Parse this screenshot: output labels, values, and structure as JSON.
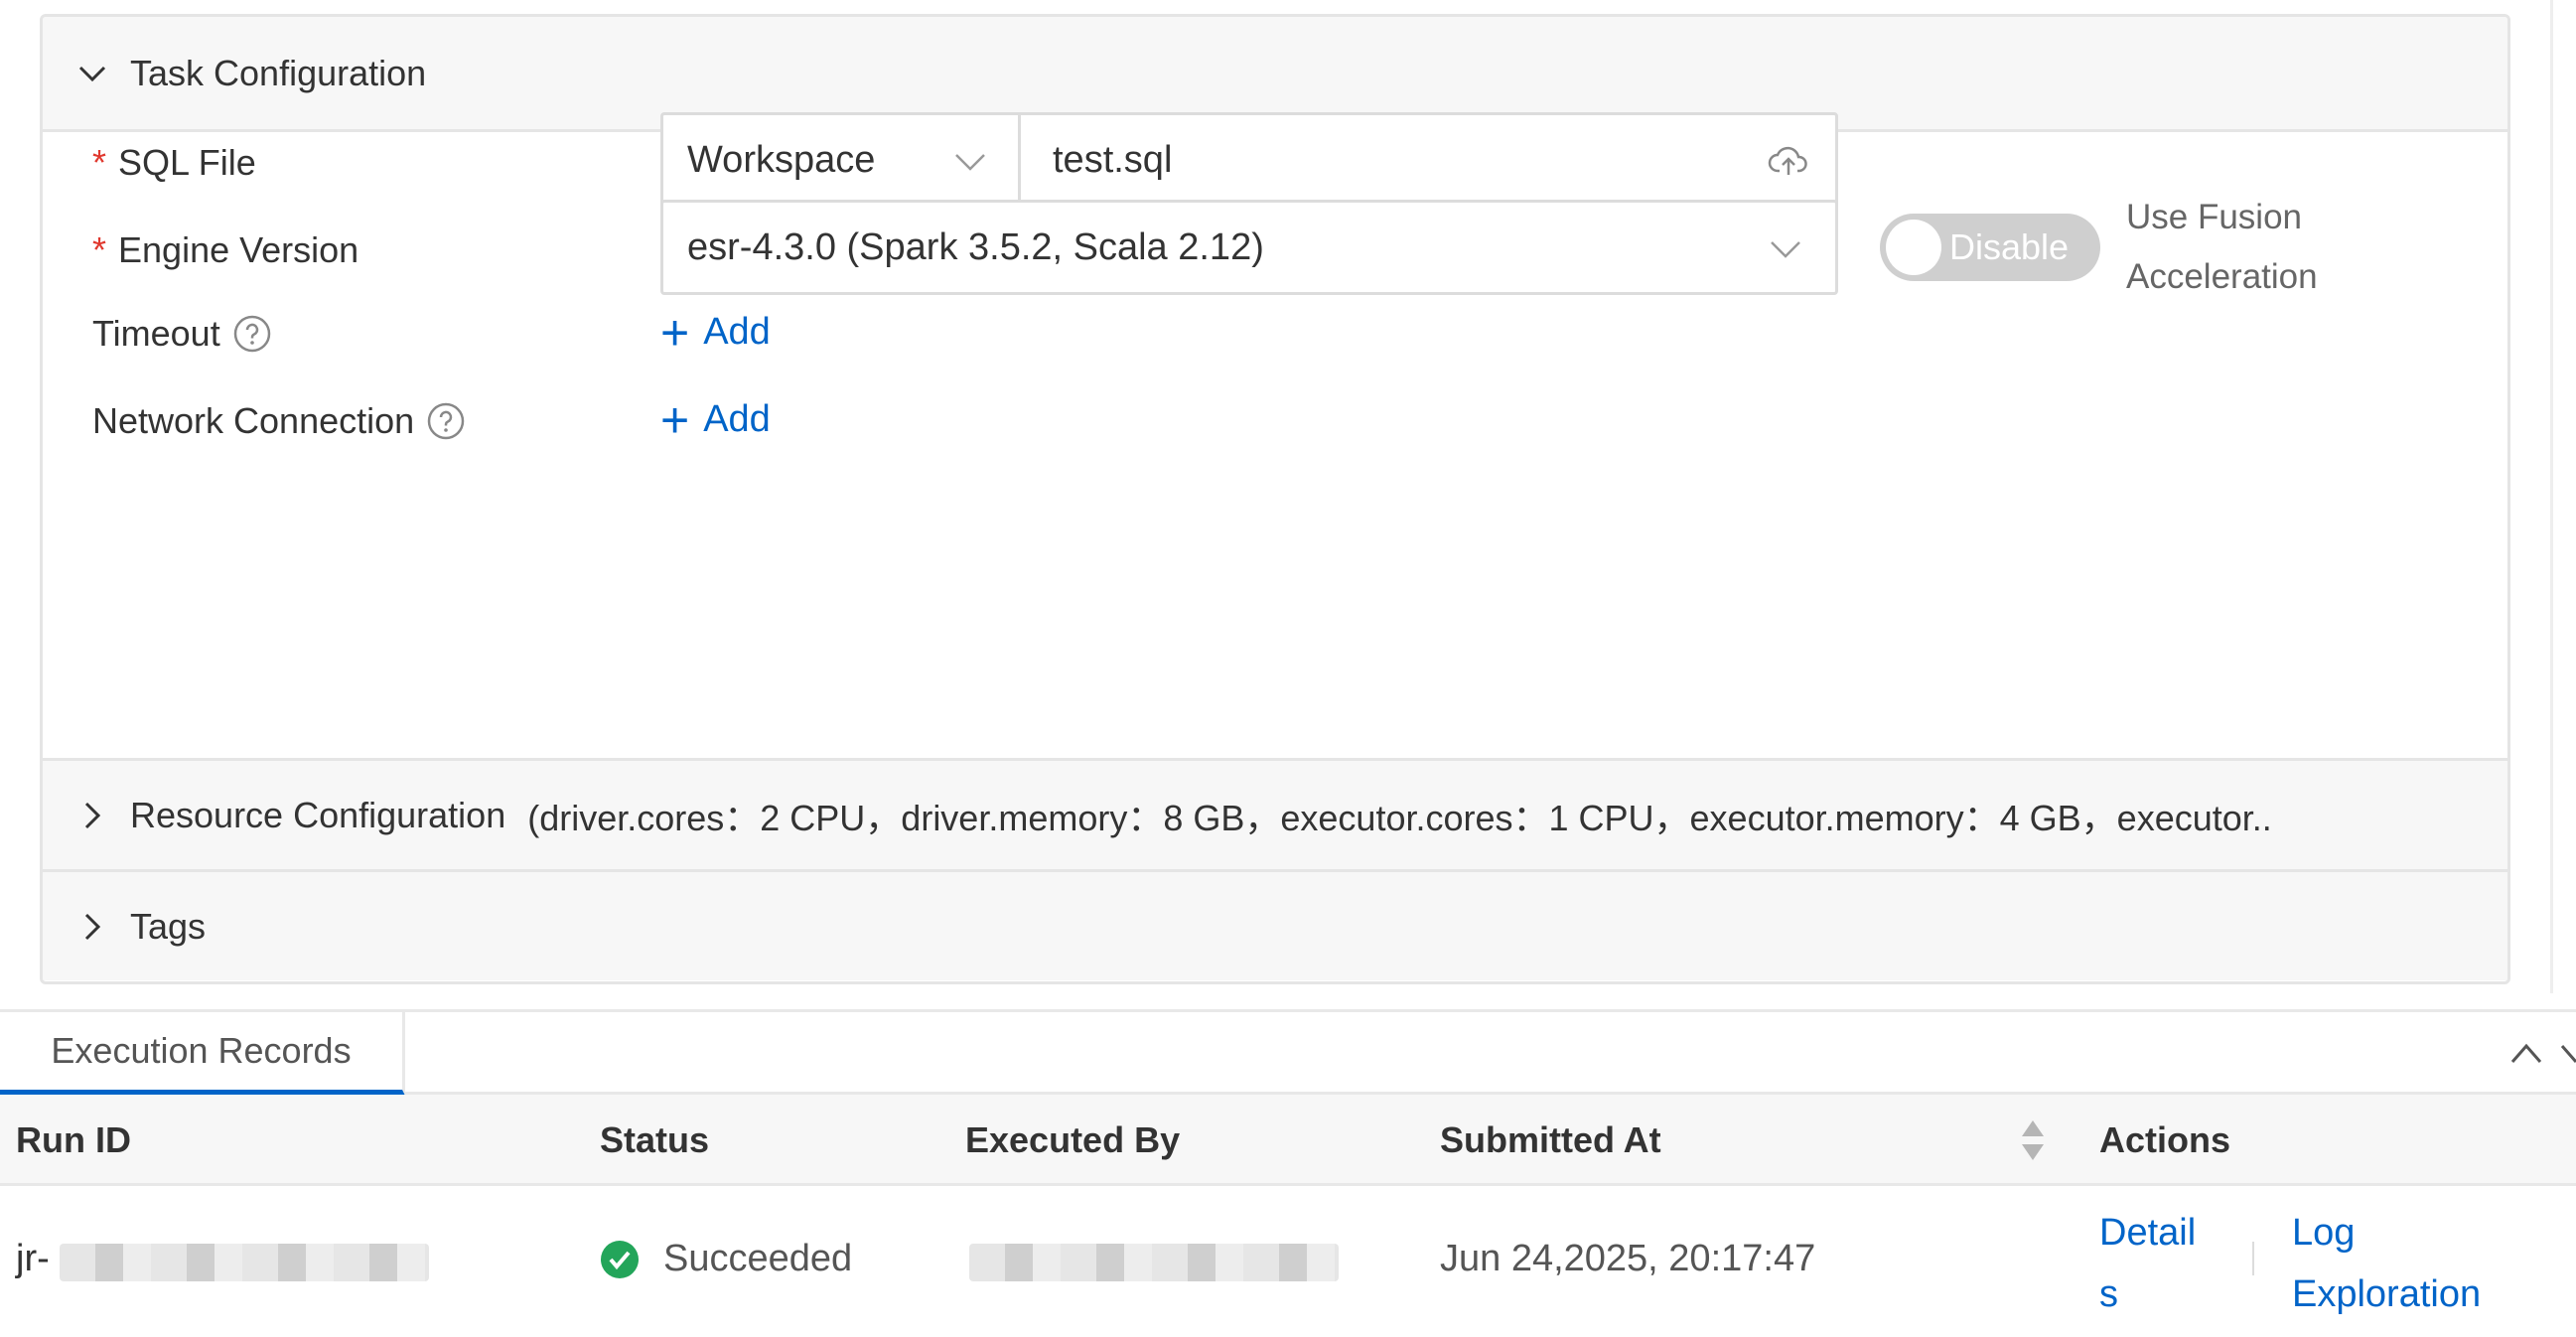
{
  "task_config": {
    "section_title": "Task Configuration",
    "sql_file": {
      "label": "SQL File",
      "required_mark": "*",
      "source_value": "Workspace",
      "file_value": "test.sql"
    },
    "engine_version": {
      "label": "Engine Version",
      "required_mark": "*",
      "value": "esr-4.3.0 (Spark 3.5.2, Scala 2.12)",
      "fusion_toggle_label": "Disable",
      "fusion_toggle_on": false,
      "fusion_label_line1": "Use Fusion",
      "fusion_label_line2": "Acceleration"
    },
    "timeout": {
      "label": "Timeout",
      "add_label": "Add"
    },
    "network_connection": {
      "label": "Network Connection",
      "add_label": "Add"
    },
    "resource_configuration": {
      "label": "Resource Configuration",
      "summary": "(driver.cores：2 CPU，driver.memory：8 GB，executor.cores：1 CPU，executor.memory：4 GB，executor.."
    },
    "tags": {
      "label": "Tags"
    }
  },
  "execution_records": {
    "tab_label": "Execution Records",
    "columns": {
      "run_id": "Run ID",
      "status": "Status",
      "executed_by": "Executed By",
      "submitted_at": "Submitted At",
      "actions": "Actions"
    },
    "rows": [
      {
        "run_id_prefix": "jr-",
        "status": "Succeeded",
        "submitted_at": "Jun 24,2025, 20:17:47",
        "details_line1": "Detail",
        "details_line2": "s",
        "log_line1": "Log",
        "log_line2": "Exploration"
      }
    ]
  },
  "colors": {
    "accent": "#0064c8",
    "required": "#e0382e",
    "success": "#23a55a",
    "toggle_off": "#cfcfcf"
  },
  "icons": {
    "collapse": "chevron-down-icon",
    "expand": "chevron-right-icon",
    "help": "question-circle-icon",
    "upload": "cloud-upload-icon",
    "success": "check-circle-icon",
    "sort": "sort-icon"
  }
}
